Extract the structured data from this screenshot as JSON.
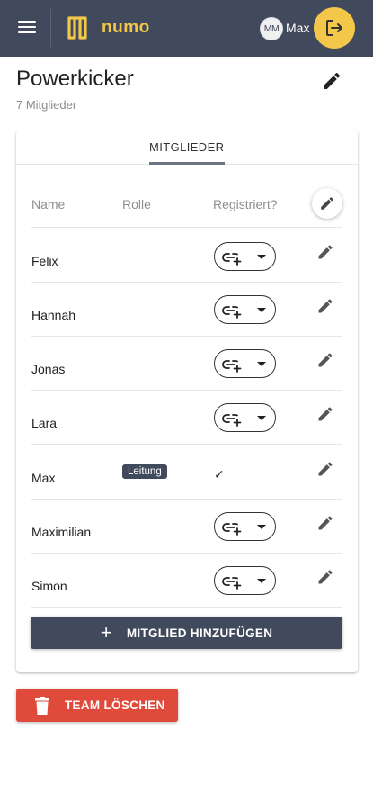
{
  "app": {
    "logo_text": "numo",
    "brand_color": "#f3c84a",
    "header_color": "#414a5c"
  },
  "user": {
    "initials": "MM",
    "name": "Max"
  },
  "team": {
    "title": "Powerkicker",
    "member_count": "7 Mitglieder"
  },
  "tabs": [
    {
      "label": "MITGLIEDER",
      "active": true
    }
  ],
  "table": {
    "headers": {
      "name": "Name",
      "role": "Rolle",
      "registered": "Registriert?"
    },
    "rows": [
      {
        "name": "Felix",
        "role": "",
        "registered": "link-select"
      },
      {
        "name": "Hannah",
        "role": "",
        "registered": "link-select"
      },
      {
        "name": "Jonas",
        "role": "",
        "registered": "link-select"
      },
      {
        "name": "Lara",
        "role": "",
        "registered": "link-select"
      },
      {
        "name": "Max",
        "role": "Leitung",
        "registered": "✓"
      },
      {
        "name": "Maximilian",
        "role": "",
        "registered": "link-select"
      },
      {
        "name": "Simon",
        "role": "",
        "registered": "link-select"
      }
    ]
  },
  "actions": {
    "add_member": "MITGLIED HINZUFÜGEN",
    "delete_team": "TEAM LÖSCHEN",
    "delete_color": "#e04a3a"
  },
  "icons": [
    "menu-icon",
    "logo-icon",
    "logout-icon",
    "edit-icon",
    "link-add-icon",
    "caret-down-icon",
    "plus-icon",
    "trash-icon"
  ]
}
